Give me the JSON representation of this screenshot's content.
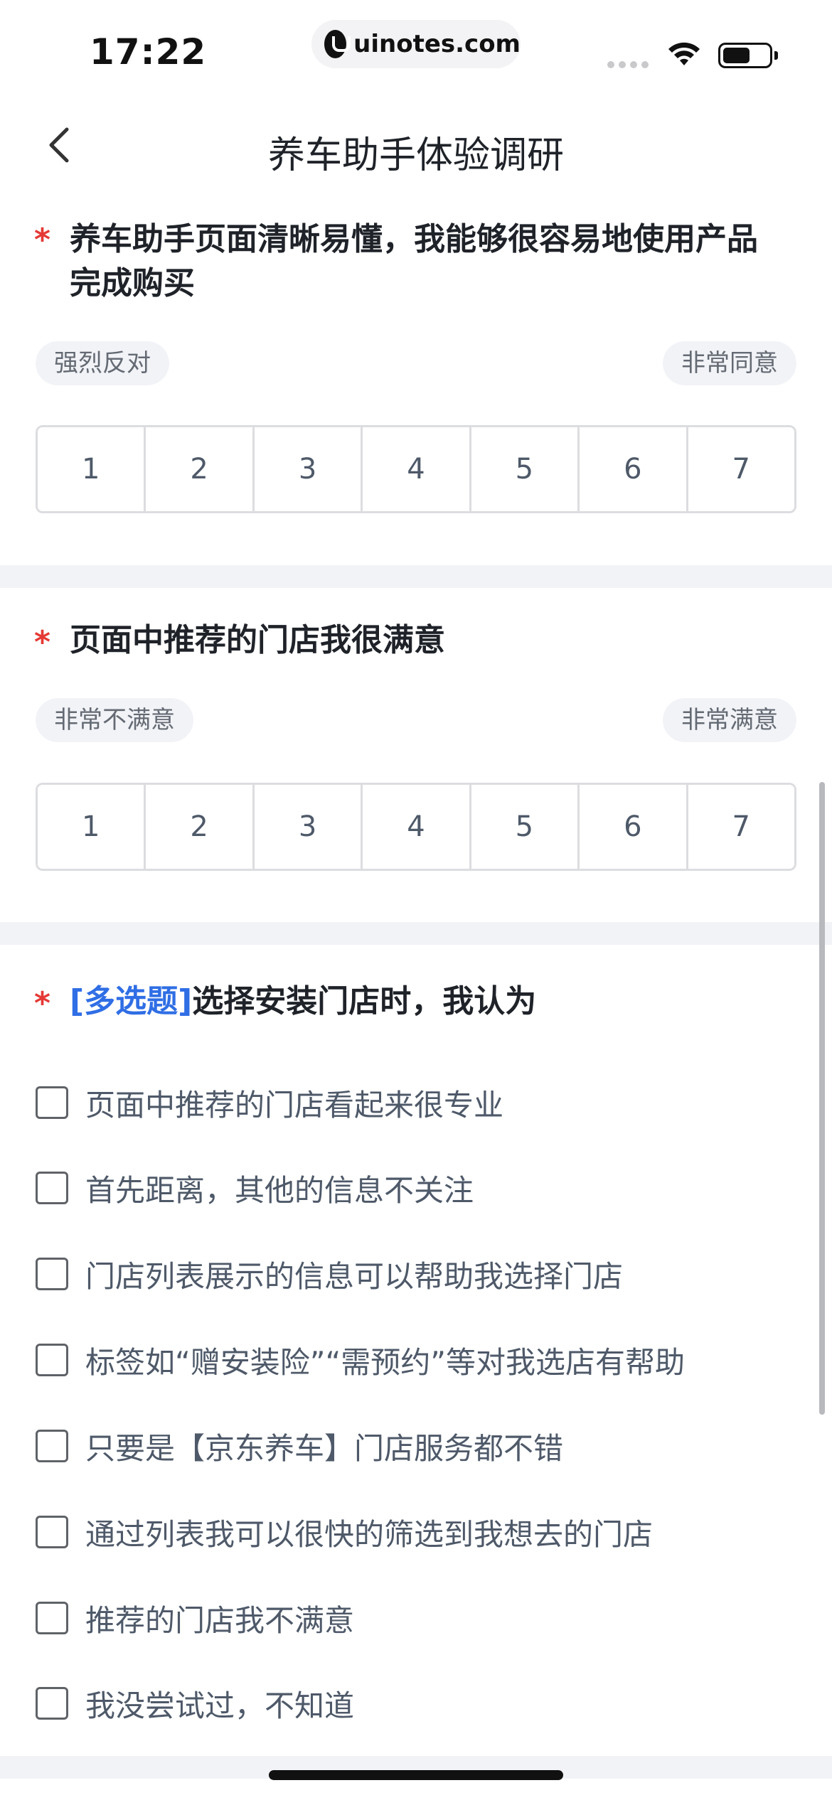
{
  "status_bar": {
    "time": "17:22",
    "url": "uinotes.com"
  },
  "nav": {
    "title": "养车助手体验调研",
    "back_icon": "chevron-left-icon"
  },
  "questions": [
    {
      "required_mark": "*",
      "title": "养车助手页面清晰易懂，我能够很容易地使用产品完成购买",
      "left_label": "强烈反对",
      "right_label": "非常同意",
      "scale": [
        "1",
        "2",
        "3",
        "4",
        "5",
        "6",
        "7"
      ]
    },
    {
      "required_mark": "*",
      "title": "页面中推荐的门店我很满意",
      "left_label": "非常不满意",
      "right_label": "非常满意",
      "scale": [
        "1",
        "2",
        "3",
        "4",
        "5",
        "6",
        "7"
      ]
    },
    {
      "required_mark": "*",
      "tag": "[多选题]",
      "title": "选择安装门店时，我认为",
      "options": [
        "页面中推荐的门店看起来很专业",
        "首先距离，其他的信息不关注",
        "门店列表展示的信息可以帮助我选择门店",
        "标签如“赠安装险”“需预约”等对我选店有帮助",
        "只要是【京东养车】门店服务都不错",
        "通过列表我可以很快的筛选到我想去的门店",
        "推荐的门店我不满意",
        "我没尝试过，不知道"
      ]
    }
  ],
  "colors": {
    "required": "#e53935",
    "tag": "#2f6ee5",
    "divider": "#f2f3f7"
  }
}
